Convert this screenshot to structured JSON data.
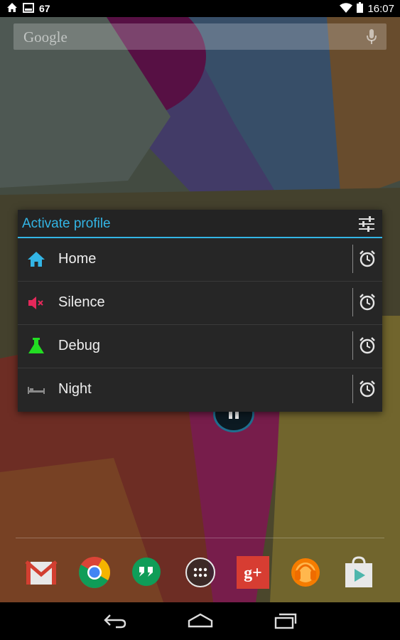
{
  "status_bar": {
    "notification_count": "67",
    "time": "16:07",
    "icons": [
      "home-icon",
      "image-icon",
      "wifi-icon",
      "battery-icon"
    ]
  },
  "search": {
    "label": "Google",
    "icon": "mic-icon"
  },
  "dialog": {
    "title": "Activate profile",
    "settings_icon": "sliders-icon",
    "accent_color": "#33b5e5",
    "profiles": [
      {
        "label": "Home",
        "icon": "house-icon",
        "color": "#33b5e5",
        "action_icon": "alarm-clock-icon"
      },
      {
        "label": "Silence",
        "icon": "speaker-mute-icon",
        "color": "#e5285a",
        "action_icon": "alarm-clock-icon"
      },
      {
        "label": "Debug",
        "icon": "flask-icon",
        "color": "#22dd22",
        "action_icon": "alarm-clock-icon"
      },
      {
        "label": "Night",
        "icon": "bed-icon",
        "color": "#8a8a8a",
        "action_icon": "alarm-clock-icon"
      }
    ]
  },
  "dock": {
    "apps": [
      "gmail-icon",
      "chrome-icon",
      "hangouts-icon",
      "app-drawer-icon",
      "google-plus-icon",
      "play-music-icon",
      "play-store-icon"
    ],
    "google_plus_label": "g+"
  },
  "nav_bar": {
    "buttons": [
      "back-icon",
      "home-nav-icon",
      "recents-icon"
    ]
  }
}
